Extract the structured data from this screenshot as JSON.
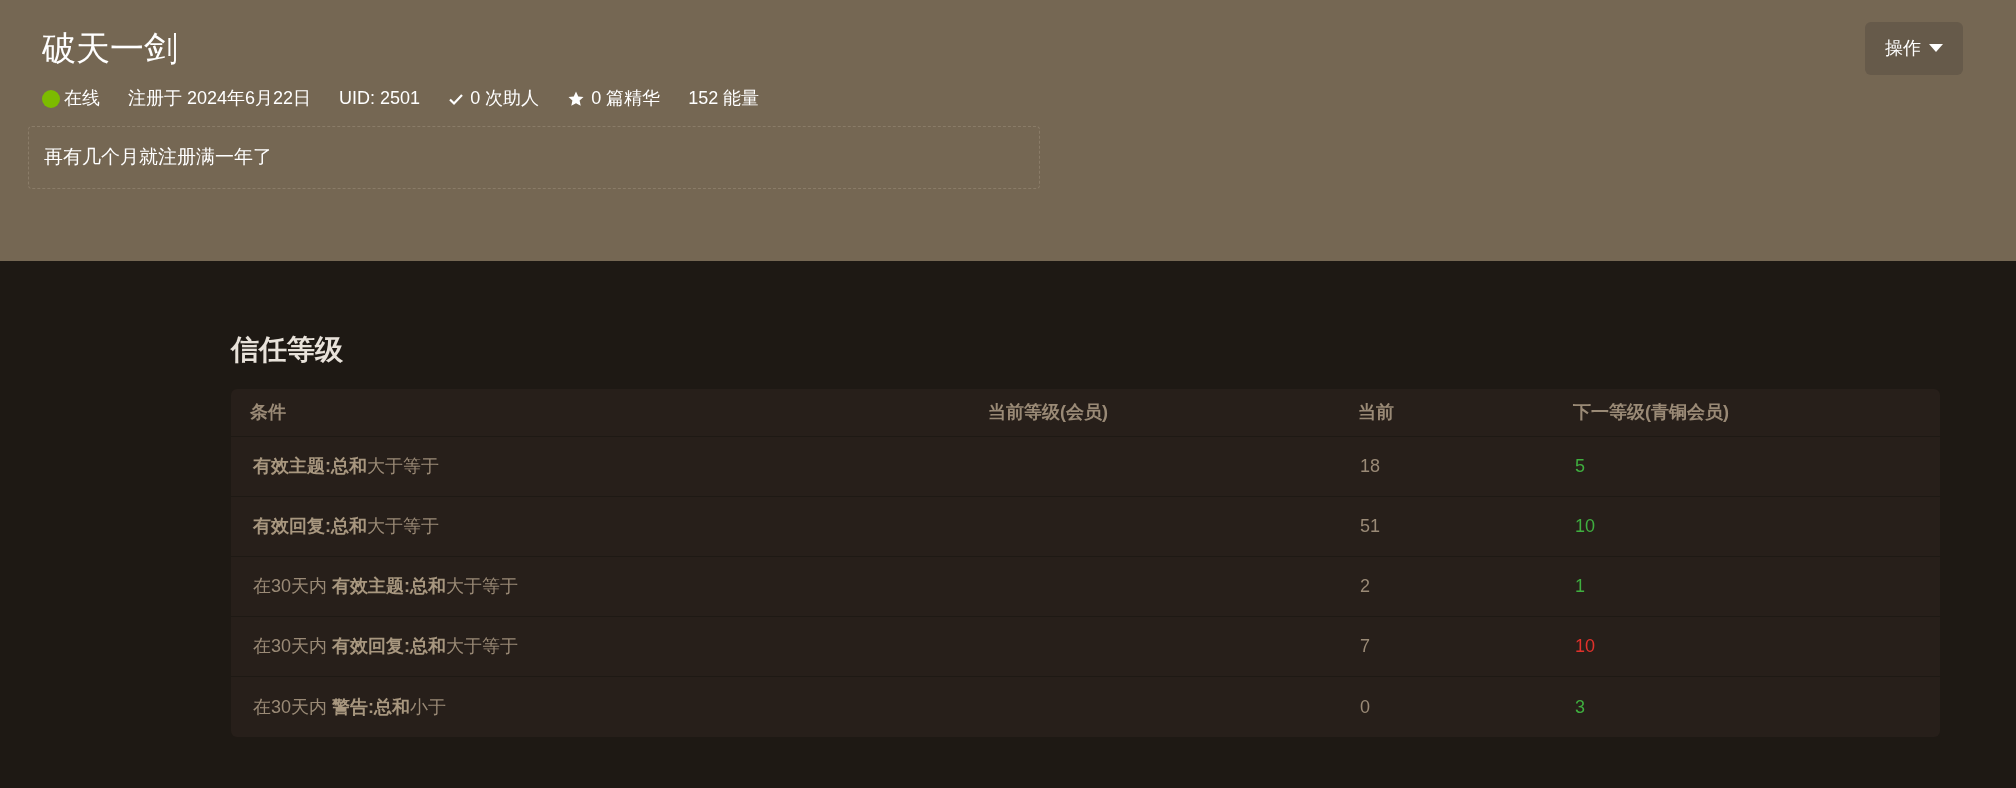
{
  "profile": {
    "name": "破天一剑",
    "action_button": "操作",
    "status": {
      "label": "在线",
      "online": true
    },
    "meta": [
      {
        "kind": "text",
        "label": "注册于 2024年6月22日"
      },
      {
        "kind": "text",
        "label": "UID: 2501"
      },
      {
        "kind": "check",
        "label": "0 次助人"
      },
      {
        "kind": "star",
        "label": "0 篇精华"
      },
      {
        "kind": "text",
        "label": "152 能量"
      }
    ],
    "bio": "再有几个月就注册满一年了"
  },
  "trust": {
    "title": "信任等级",
    "columns": [
      "条件",
      "当前等级(会员)",
      "当前",
      "下一等级(青铜会员)"
    ],
    "rows": [
      {
        "condition": "**有效主题:总和**大于等于",
        "current": "18",
        "next": "5",
        "met": true
      },
      {
        "condition": "**有效回复:总和**大于等于",
        "current": "51",
        "next": "10",
        "met": true
      },
      {
        "condition": "在30天内 **有效主题:总和**大于等于",
        "current": "2",
        "next": "1",
        "met": true
      },
      {
        "condition": "在30天内 **有效回复:总和**大于等于",
        "current": "7",
        "next": "10",
        "met": false
      },
      {
        "condition": "在30天内 **警告:总和**小于",
        "current": "0",
        "next": "3",
        "met": true
      }
    ]
  }
}
